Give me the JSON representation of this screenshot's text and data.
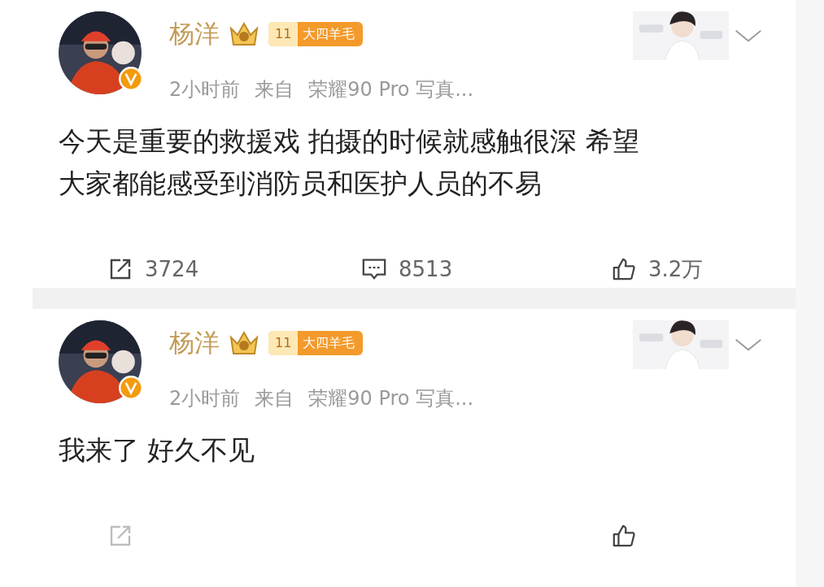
{
  "posts": [
    {
      "author": {
        "name": "杨洋",
        "verified": true,
        "rank_number": "11",
        "member_badge": "大四羊毛"
      },
      "meta": {
        "time": "2小时前",
        "source_prefix": "来自",
        "source": "荣耀90 Pro 写真..."
      },
      "text": "今天是重要的救援戏 拍摄的时候就感触很深 希望大家都能感受到消防员和医护人员的不易",
      "actions": [
        {
          "kind": "repost",
          "count": "3724"
        },
        {
          "kind": "comment",
          "count": "8513"
        },
        {
          "kind": "like",
          "count": "3.2万"
        }
      ]
    },
    {
      "author": {
        "name": "杨洋",
        "verified": true,
        "rank_number": "11",
        "member_badge": "大四羊毛"
      },
      "meta": {
        "time": "2小时前",
        "source_prefix": "来自",
        "source": "荣耀90 Pro 写真..."
      },
      "text": "我来了 好久不见",
      "actions": [
        {
          "kind": "repost"
        },
        {
          "kind": "like"
        }
      ]
    }
  ]
}
